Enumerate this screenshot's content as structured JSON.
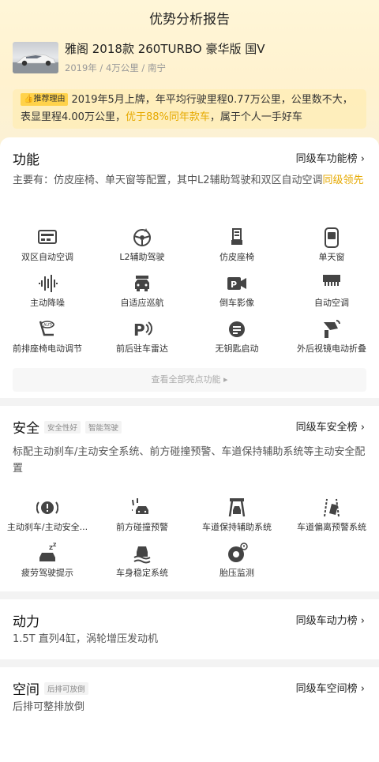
{
  "page_title": "优势分析报告",
  "car": {
    "name": "雅阁 2018款 260TURBO 豪华版 国V",
    "meta": "2019年 / 4万公里 / 南宁"
  },
  "reason": {
    "tag": "推荐理由",
    "text_1": "2019年5月上牌，年平均行驶里程0.77万公里，公里数不大，表显里程4.00万公里，",
    "highlight": "优于88%同年款车",
    "text_2": "，属于个人一手好车"
  },
  "function": {
    "title": "功能",
    "link": "同级车功能榜 ›",
    "desc": "主要有：仿皮座椅、单天窗等配置，其中L2辅助驾驶和双区自动空调",
    "desc_hl": "同级领先",
    "features": [
      {
        "label": "双区自动空调",
        "icon": "ac-panel-icon"
      },
      {
        "label": "L2辅助驾驶",
        "icon": "steering-wheel-icon"
      },
      {
        "label": "仿皮座椅",
        "icon": "seat-icon"
      },
      {
        "label": "单天窗",
        "icon": "sunroof-icon"
      },
      {
        "label": "主动降噪",
        "icon": "sound-wave-icon"
      },
      {
        "label": "自适应巡航",
        "icon": "cruise-car-icon"
      },
      {
        "label": "倒车影像",
        "icon": "camera-p-icon"
      },
      {
        "label": "自动空调",
        "icon": "ac-vent-icon"
      },
      {
        "label": "前排座椅电动调节",
        "icon": "auto-seat-icon"
      },
      {
        "label": "前后驻车雷达",
        "icon": "parking-radar-icon"
      },
      {
        "label": "无钥匙启动",
        "icon": "keyless-start-icon"
      },
      {
        "label": "外后视镜电动折叠",
        "icon": "mirror-fold-icon"
      }
    ],
    "view_all": "查看全部亮点功能 ▸"
  },
  "safety": {
    "title": "安全",
    "tags": [
      "安全性好",
      "智能驾驶"
    ],
    "link": "同级车安全榜 ›",
    "desc": "标配主动刹车/主动安全系统、前方碰撞预警、车道保持辅助系统等主动安全配置",
    "features": [
      {
        "label": "主动刹车/主动安全...",
        "icon": "brake-warning-icon"
      },
      {
        "label": "前方碰撞预警",
        "icon": "collision-warning-icon"
      },
      {
        "label": "车道保持辅助系统",
        "icon": "lane-keep-icon"
      },
      {
        "label": "车道偏离预警系统",
        "icon": "lane-departure-icon"
      },
      {
        "label": "疲劳驾驶提示",
        "icon": "fatigue-icon"
      },
      {
        "label": "车身稳定系统",
        "icon": "stability-icon"
      },
      {
        "label": "胎压监测",
        "icon": "tire-pressure-icon"
      }
    ]
  },
  "power": {
    "title": "动力",
    "link": "同级车动力榜 ›",
    "desc": "1.5T 直列4缸，涡轮增压发动机"
  },
  "space": {
    "title": "空间",
    "tag": "后排可放倒",
    "link": "同级车空间榜 ›",
    "desc": "后排可整排放倒"
  },
  "colors": {
    "accent": "#e6a900",
    "tag_yellow": "#ffd24a"
  }
}
